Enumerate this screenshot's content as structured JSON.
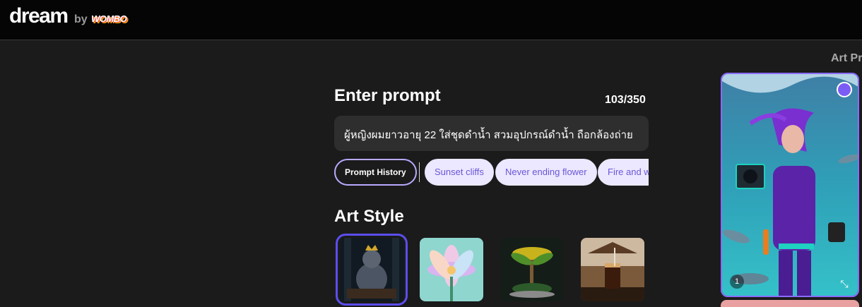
{
  "header": {
    "logo": "dream",
    "by": "by",
    "wombo": "WOMBO"
  },
  "side": {
    "art_prefs": "Art Pre"
  },
  "prompt": {
    "title": "Enter prompt",
    "counter": "103/350",
    "value": "ผู้หญิงผมยาวอายุ 22 ใส่ชุดดำน้ำ สวมอุปกรณ์ดำน้ำ ถือกล้องถ่าย",
    "chips": [
      {
        "label": "Prompt History"
      },
      {
        "label": "Sunset cliffs"
      },
      {
        "label": "Never ending flower"
      },
      {
        "label": "Fire and w"
      }
    ]
  },
  "art_style": {
    "title": "Art Style",
    "styles": [
      {
        "name": "cat-king",
        "selected": true
      },
      {
        "name": "flower"
      },
      {
        "name": "palm"
      },
      {
        "name": "drink"
      }
    ]
  },
  "preview": {
    "index": "1"
  },
  "colors": {
    "accent": "#5b4ef0",
    "chip_bg": "#ebe8ff",
    "chip_text": "#6c55d6"
  }
}
